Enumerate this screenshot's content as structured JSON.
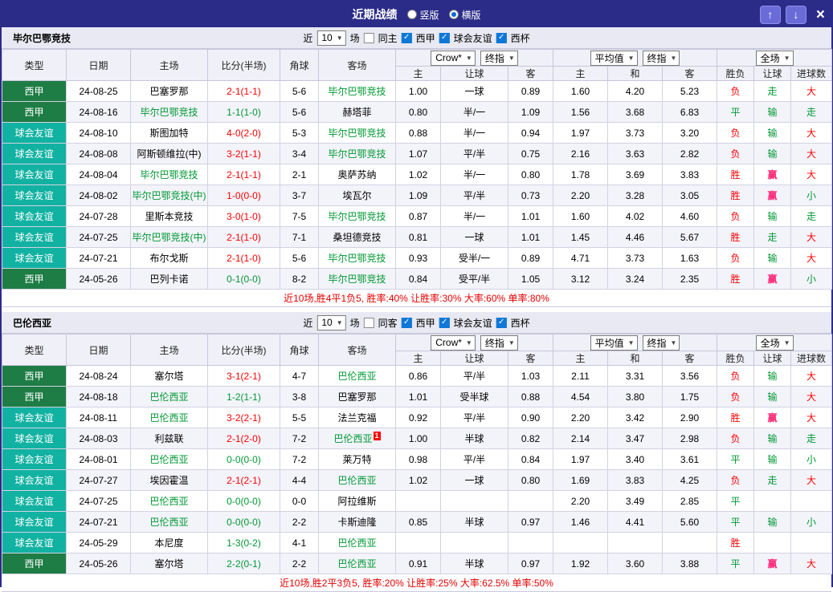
{
  "titlebar": {
    "title": "近期战绩",
    "mode_vertical": "竖版",
    "mode_horizontal": "横版",
    "selected_mode": "横版",
    "up_icon": "↑",
    "down_icon": "↓",
    "close_icon": "×"
  },
  "colors": {
    "accent_indigo": "#2b2b88",
    "liga_green": "#1e7d45",
    "friendly_teal": "#12b2a2",
    "win_red": "#ff0000",
    "draw_green": "#009933",
    "handicap_win_pink": "#ff2d78",
    "summary_red": "#e60000"
  },
  "sections": [
    {
      "team": "毕尔巴鄂竞技",
      "filters": {
        "near": "近",
        "count": "10",
        "games": "场",
        "same_label": "同主",
        "same_checked": false,
        "comps": [
          {
            "label": "西甲",
            "checked": true
          },
          {
            "label": "球会友谊",
            "checked": true
          },
          {
            "label": "西杯",
            "checked": true
          }
        ]
      },
      "dropdowns": {
        "company": "Crow*",
        "final_a": "终指",
        "average": "平均值",
        "final_b": "终指",
        "scope": "全场"
      },
      "columns": [
        "类型",
        "日期",
        "主场",
        "比分(半场)",
        "角球",
        "客场",
        "主",
        "让球",
        "客",
        "主",
        "和",
        "客",
        "胜负",
        "让球",
        "进球数"
      ],
      "rows": [
        {
          "type": {
            "text": "西甲",
            "cls": "t-liga"
          },
          "date": "24-08-25",
          "home": {
            "text": "巴塞罗那"
          },
          "score": {
            "text": "2-1(1-1)",
            "cls": "c-red"
          },
          "corner": "5-6",
          "away": {
            "text": "毕尔巴鄂竞技",
            "self": true
          },
          "o1": "1.00",
          "o2": "一球",
          "o3": "0.89",
          "a1": "1.60",
          "a2": "4.20",
          "a3": "5.23",
          "res": {
            "text": "负",
            "cls": "c-red"
          },
          "han": {
            "text": "走",
            "cls": "c-green"
          },
          "goal": {
            "text": "大",
            "cls": "c-red"
          }
        },
        {
          "type": {
            "text": "西甲",
            "cls": "t-liga"
          },
          "date": "24-08-16",
          "home": {
            "text": "毕尔巴鄂竞技",
            "self": true
          },
          "score": {
            "text": "1-1(1-0)",
            "cls": "c-green"
          },
          "corner": "5-6",
          "away": {
            "text": "赫塔菲"
          },
          "o1": "0.80",
          "o2": "半/一",
          "o3": "1.09",
          "a1": "1.56",
          "a2": "3.68",
          "a3": "6.83",
          "res": {
            "text": "平",
            "cls": "c-green"
          },
          "han": {
            "text": "输",
            "cls": "c-green"
          },
          "goal": {
            "text": "走",
            "cls": "c-green"
          }
        },
        {
          "type": {
            "text": "球会友谊",
            "cls": "t-friend"
          },
          "date": "24-08-10",
          "home": {
            "text": "斯图加特"
          },
          "score": {
            "text": "4-0(2-0)",
            "cls": "c-red"
          },
          "corner": "5-3",
          "away": {
            "text": "毕尔巴鄂竞技",
            "self": true
          },
          "o1": "0.88",
          "o2": "半/一",
          "o3": "0.94",
          "a1": "1.97",
          "a2": "3.73",
          "a3": "3.20",
          "res": {
            "text": "负",
            "cls": "c-red"
          },
          "han": {
            "text": "输",
            "cls": "c-green"
          },
          "goal": {
            "text": "大",
            "cls": "c-red"
          }
        },
        {
          "type": {
            "text": "球会友谊",
            "cls": "t-friend"
          },
          "date": "24-08-08",
          "home": {
            "text": "阿斯顿维拉(中)"
          },
          "score": {
            "text": "3-2(1-1)",
            "cls": "c-red"
          },
          "corner": "3-4",
          "away": {
            "text": "毕尔巴鄂竞技",
            "self": true
          },
          "o1": "1.07",
          "o2": "平/半",
          "o3": "0.75",
          "a1": "2.16",
          "a2": "3.63",
          "a3": "2.82",
          "res": {
            "text": "负",
            "cls": "c-red"
          },
          "han": {
            "text": "输",
            "cls": "c-green"
          },
          "goal": {
            "text": "大",
            "cls": "c-red"
          }
        },
        {
          "type": {
            "text": "球会友谊",
            "cls": "t-friend"
          },
          "date": "24-08-04",
          "home": {
            "text": "毕尔巴鄂竞技",
            "self": true
          },
          "score": {
            "text": "2-1(1-1)",
            "cls": "c-red"
          },
          "corner": "2-1",
          "away": {
            "text": "奥萨苏纳"
          },
          "o1": "1.02",
          "o2": "半/一",
          "o3": "0.80",
          "a1": "1.78",
          "a2": "3.69",
          "a3": "3.83",
          "res": {
            "text": "胜",
            "cls": "c-red"
          },
          "han": {
            "text": "赢",
            "cls": "c-pink"
          },
          "goal": {
            "text": "大",
            "cls": "c-red"
          }
        },
        {
          "type": {
            "text": "球会友谊",
            "cls": "t-friend"
          },
          "date": "24-08-02",
          "home": {
            "text": "毕尔巴鄂竞技(中)",
            "self": true
          },
          "score": {
            "text": "1-0(0-0)",
            "cls": "c-red"
          },
          "corner": "3-7",
          "away": {
            "text": "埃瓦尔"
          },
          "o1": "1.09",
          "o2": "平/半",
          "o3": "0.73",
          "a1": "2.20",
          "a2": "3.28",
          "a3": "3.05",
          "res": {
            "text": "胜",
            "cls": "c-red"
          },
          "han": {
            "text": "赢",
            "cls": "c-pink"
          },
          "goal": {
            "text": "小",
            "cls": "c-green"
          }
        },
        {
          "type": {
            "text": "球会友谊",
            "cls": "t-friend"
          },
          "date": "24-07-28",
          "home": {
            "text": "里斯本竞技"
          },
          "score": {
            "text": "3-0(1-0)",
            "cls": "c-red"
          },
          "corner": "7-5",
          "away": {
            "text": "毕尔巴鄂竞技",
            "self": true
          },
          "o1": "0.87",
          "o2": "半/一",
          "o3": "1.01",
          "a1": "1.60",
          "a2": "4.02",
          "a3": "4.60",
          "res": {
            "text": "负",
            "cls": "c-red"
          },
          "han": {
            "text": "输",
            "cls": "c-green"
          },
          "goal": {
            "text": "走",
            "cls": "c-green"
          }
        },
        {
          "type": {
            "text": "球会友谊",
            "cls": "t-friend"
          },
          "date": "24-07-25",
          "home": {
            "text": "毕尔巴鄂竞技(中)",
            "self": true
          },
          "score": {
            "text": "2-1(1-0)",
            "cls": "c-red"
          },
          "corner": "7-1",
          "away": {
            "text": "桑坦德竞技"
          },
          "o1": "0.81",
          "o2": "一球",
          "o3": "1.01",
          "a1": "1.45",
          "a2": "4.46",
          "a3": "5.67",
          "res": {
            "text": "胜",
            "cls": "c-red"
          },
          "han": {
            "text": "走",
            "cls": "c-green"
          },
          "goal": {
            "text": "大",
            "cls": "c-red"
          }
        },
        {
          "type": {
            "text": "球会友谊",
            "cls": "t-friend"
          },
          "date": "24-07-21",
          "home": {
            "text": "布尔戈斯"
          },
          "score": {
            "text": "2-1(1-0)",
            "cls": "c-red"
          },
          "corner": "5-6",
          "away": {
            "text": "毕尔巴鄂竞技",
            "self": true
          },
          "o1": "0.93",
          "o2": "受半/一",
          "o3": "0.89",
          "a1": "4.71",
          "a2": "3.73",
          "a3": "1.63",
          "res": {
            "text": "负",
            "cls": "c-red"
          },
          "han": {
            "text": "输",
            "cls": "c-green"
          },
          "goal": {
            "text": "大",
            "cls": "c-red"
          }
        },
        {
          "type": {
            "text": "西甲",
            "cls": "t-liga"
          },
          "date": "24-05-26",
          "home": {
            "text": "巴列卡诺"
          },
          "score": {
            "text": "0-1(0-0)",
            "cls": "c-green"
          },
          "corner": "8-2",
          "away": {
            "text": "毕尔巴鄂竞技",
            "self": true
          },
          "o1": "0.84",
          "o2": "受平/半",
          "o3": "1.05",
          "a1": "3.12",
          "a2": "3.24",
          "a3": "2.35",
          "res": {
            "text": "胜",
            "cls": "c-red"
          },
          "han": {
            "text": "赢",
            "cls": "c-pink"
          },
          "goal": {
            "text": "小",
            "cls": "c-green"
          }
        }
      ],
      "summary": "近10场,胜4平1负5, 胜率:40% 让胜率:30% 大率:60% 单率:80%"
    },
    {
      "team": "巴伦西亚",
      "filters": {
        "near": "近",
        "count": "10",
        "games": "场",
        "same_label": "同客",
        "same_checked": false,
        "comps": [
          {
            "label": "西甲",
            "checked": true
          },
          {
            "label": "球会友谊",
            "checked": true
          },
          {
            "label": "西杯",
            "checked": true
          }
        ]
      },
      "dropdowns": {
        "company": "Crow*",
        "final_a": "终指",
        "average": "平均值",
        "final_b": "终指",
        "scope": "全场"
      },
      "columns": [
        "类型",
        "日期",
        "主场",
        "比分(半场)",
        "角球",
        "客场",
        "主",
        "让球",
        "客",
        "主",
        "和",
        "客",
        "胜负",
        "让球",
        "进球数"
      ],
      "rows": [
        {
          "type": {
            "text": "西甲",
            "cls": "t-liga"
          },
          "date": "24-08-24",
          "home": {
            "text": "塞尔塔"
          },
          "score": {
            "text": "3-1(2-1)",
            "cls": "c-red"
          },
          "corner": "4-7",
          "away": {
            "text": "巴伦西亚",
            "self": true
          },
          "o1": "0.86",
          "o2": "平/半",
          "o3": "1.03",
          "a1": "2.11",
          "a2": "3.31",
          "a3": "3.56",
          "res": {
            "text": "负",
            "cls": "c-red"
          },
          "han": {
            "text": "输",
            "cls": "c-green"
          },
          "goal": {
            "text": "大",
            "cls": "c-red"
          }
        },
        {
          "type": {
            "text": "西甲",
            "cls": "t-liga"
          },
          "date": "24-08-18",
          "home": {
            "text": "巴伦西亚",
            "self": true
          },
          "score": {
            "text": "1-2(1-1)",
            "cls": "c-green"
          },
          "corner": "3-8",
          "away": {
            "text": "巴塞罗那"
          },
          "o1": "1.01",
          "o2": "受半球",
          "o3": "0.88",
          "a1": "4.54",
          "a2": "3.80",
          "a3": "1.75",
          "res": {
            "text": "负",
            "cls": "c-red"
          },
          "han": {
            "text": "输",
            "cls": "c-green"
          },
          "goal": {
            "text": "大",
            "cls": "c-red"
          }
        },
        {
          "type": {
            "text": "球会友谊",
            "cls": "t-friend"
          },
          "date": "24-08-11",
          "home": {
            "text": "巴伦西亚",
            "self": true
          },
          "score": {
            "text": "3-2(2-1)",
            "cls": "c-red"
          },
          "corner": "5-5",
          "away": {
            "text": "法兰克福"
          },
          "o1": "0.92",
          "o2": "平/半",
          "o3": "0.90",
          "a1": "2.20",
          "a2": "3.42",
          "a3": "2.90",
          "res": {
            "text": "胜",
            "cls": "c-red"
          },
          "han": {
            "text": "赢",
            "cls": "c-pink"
          },
          "goal": {
            "text": "大",
            "cls": "c-red"
          }
        },
        {
          "type": {
            "text": "球会友谊",
            "cls": "t-friend"
          },
          "date": "24-08-03",
          "home": {
            "text": "利兹联"
          },
          "score": {
            "text": "2-1(2-0)",
            "cls": "c-red"
          },
          "corner": "7-2",
          "away": {
            "text": "巴伦西亚",
            "self": true,
            "badge": "1"
          },
          "o1": "1.00",
          "o2": "半球",
          "o3": "0.82",
          "a1": "2.14",
          "a2": "3.47",
          "a3": "2.98",
          "res": {
            "text": "负",
            "cls": "c-red"
          },
          "han": {
            "text": "输",
            "cls": "c-green"
          },
          "goal": {
            "text": "走",
            "cls": "c-green"
          }
        },
        {
          "type": {
            "text": "球会友谊",
            "cls": "t-friend"
          },
          "date": "24-08-01",
          "home": {
            "text": "巴伦西亚",
            "self": true
          },
          "score": {
            "text": "0-0(0-0)",
            "cls": "c-green"
          },
          "corner": "7-2",
          "away": {
            "text": "莱万特"
          },
          "o1": "0.98",
          "o2": "平/半",
          "o3": "0.84",
          "a1": "1.97",
          "a2": "3.40",
          "a3": "3.61",
          "res": {
            "text": "平",
            "cls": "c-green"
          },
          "han": {
            "text": "输",
            "cls": "c-green"
          },
          "goal": {
            "text": "小",
            "cls": "c-green"
          }
        },
        {
          "type": {
            "text": "球会友谊",
            "cls": "t-friend"
          },
          "date": "24-07-27",
          "home": {
            "text": "埃因霍温"
          },
          "score": {
            "text": "2-1(2-1)",
            "cls": "c-red"
          },
          "corner": "4-4",
          "away": {
            "text": "巴伦西亚",
            "self": true
          },
          "o1": "1.02",
          "o2": "一球",
          "o3": "0.80",
          "a1": "1.69",
          "a2": "3.83",
          "a3": "4.25",
          "res": {
            "text": "负",
            "cls": "c-red"
          },
          "han": {
            "text": "走",
            "cls": "c-green"
          },
          "goal": {
            "text": "大",
            "cls": "c-red"
          }
        },
        {
          "type": {
            "text": "球会友谊",
            "cls": "t-friend"
          },
          "date": "24-07-25",
          "home": {
            "text": "巴伦西亚",
            "self": true
          },
          "score": {
            "text": "0-0(0-0)",
            "cls": "c-green"
          },
          "corner": "0-0",
          "away": {
            "text": "阿拉维斯"
          },
          "o1": "",
          "o2": "",
          "o3": "",
          "a1": "2.20",
          "a2": "3.49",
          "a3": "2.85",
          "res": {
            "text": "平",
            "cls": "c-green"
          },
          "han": {
            "text": "",
            "cls": ""
          },
          "goal": {
            "text": "",
            "cls": ""
          }
        },
        {
          "type": {
            "text": "球会友谊",
            "cls": "t-friend"
          },
          "date": "24-07-21",
          "home": {
            "text": "巴伦西亚",
            "self": true
          },
          "score": {
            "text": "0-0(0-0)",
            "cls": "c-green"
          },
          "corner": "2-2",
          "away": {
            "text": "卡斯迪隆"
          },
          "o1": "0.85",
          "o2": "半球",
          "o3": "0.97",
          "a1": "1.46",
          "a2": "4.41",
          "a3": "5.60",
          "res": {
            "text": "平",
            "cls": "c-green"
          },
          "han": {
            "text": "输",
            "cls": "c-green"
          },
          "goal": {
            "text": "小",
            "cls": "c-green"
          }
        },
        {
          "type": {
            "text": "球会友谊",
            "cls": "t-friend"
          },
          "date": "24-05-29",
          "home": {
            "text": "本尼度"
          },
          "score": {
            "text": "1-3(0-2)",
            "cls": "c-green"
          },
          "corner": "4-1",
          "away": {
            "text": "巴伦西亚",
            "self": true
          },
          "o1": "",
          "o2": "",
          "o3": "",
          "a1": "",
          "a2": "",
          "a3": "",
          "res": {
            "text": "胜",
            "cls": "c-red"
          },
          "han": {
            "text": "",
            "cls": ""
          },
          "goal": {
            "text": "",
            "cls": ""
          }
        },
        {
          "type": {
            "text": "西甲",
            "cls": "t-liga"
          },
          "date": "24-05-26",
          "home": {
            "text": "塞尔塔"
          },
          "score": {
            "text": "2-2(0-1)",
            "cls": "c-green"
          },
          "corner": "2-2",
          "away": {
            "text": "巴伦西亚",
            "self": true
          },
          "o1": "0.91",
          "o2": "半球",
          "o3": "0.97",
          "a1": "1.92",
          "a2": "3.60",
          "a3": "3.88",
          "res": {
            "text": "平",
            "cls": "c-green"
          },
          "han": {
            "text": "赢",
            "cls": "c-pink"
          },
          "goal": {
            "text": "大",
            "cls": "c-red"
          }
        }
      ],
      "summary": "近10场,胜2平3负5, 胜率:20% 让胜率:25% 大率:62.5% 单率:50%"
    }
  ]
}
